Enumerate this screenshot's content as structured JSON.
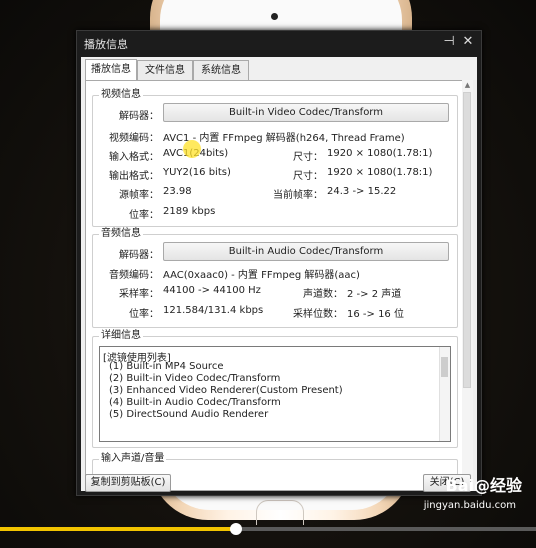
{
  "dialog": {
    "title": "播放信息",
    "pin_glyph": "⊣",
    "close_glyph": "✕"
  },
  "tabs": [
    {
      "label": "播放信息",
      "active": true
    },
    {
      "label": "文件信息",
      "active": false
    },
    {
      "label": "系统信息",
      "active": false
    }
  ],
  "video": {
    "group_label": "视频信息",
    "decoder_label": "解码器：",
    "decoder_button": "Built-in Video Codec/Transform",
    "codec_label": "视频编码：",
    "codec_value": "AVC1 - 内置 FFmpeg 解码器(h264, Thread Frame)",
    "input_format_label": "输入格式：",
    "input_format_value": "AVC1(24bits)",
    "input_size_label": "尺寸：",
    "input_size_value": "1920 × 1080(1.78:1)",
    "output_format_label": "输出格式：",
    "output_format_value": "YUY2(16 bits)",
    "output_size_label": "尺寸：",
    "output_size_value": "1920 × 1080(1.78:1)",
    "source_fps_label": "源帧率：",
    "source_fps_value": "23.98",
    "current_fps_label": "当前帧率：",
    "current_fps_value": "24.3 -> 15.22",
    "bitrate_label": "位率：",
    "bitrate_value": "2189 kbps"
  },
  "audio": {
    "group_label": "音频信息",
    "decoder_label": "解码器：",
    "decoder_button": "Built-in Audio Codec/Transform",
    "codec_label": "音频编码：",
    "codec_value": "AAC(0xaac0) - 内置 FFmpeg 解码器(aac)",
    "sample_rate_label": "采样率：",
    "sample_rate_value": "44100 -> 44100 Hz",
    "channels_label": "声道数：",
    "channels_value": "2 -> 2 声道",
    "bitrate_label": "位率：",
    "bitrate_value": "121.584/131.4 kbps",
    "sample_bits_label": "采样位数：",
    "sample_bits_value": "16 -> 16 位"
  },
  "details": {
    "group_label": "详细信息",
    "lines": [
      "[滤镜使用列表]",
      "(1) Built-in MP4 Source",
      "(2) Built-in Video Codec/Transform",
      "(3) Enhanced Video Renderer(Custom Present)",
      "(4) Built-in Audio Codec/Transform",
      "(5) DirectSound Audio Renderer"
    ]
  },
  "input_channels": {
    "group_label": "输入声道/音量"
  },
  "footer": {
    "copy_button": "复制到剪贴板(C)",
    "close_button": "关闭(C)"
  },
  "player": {
    "progress": 0.44
  },
  "watermark": {
    "brand": "Bai@经验",
    "url": "jingyan.baidu.com"
  },
  "colors": {
    "progress_fill": "#f2c400",
    "dialog_frame": "#1c1c1c"
  }
}
